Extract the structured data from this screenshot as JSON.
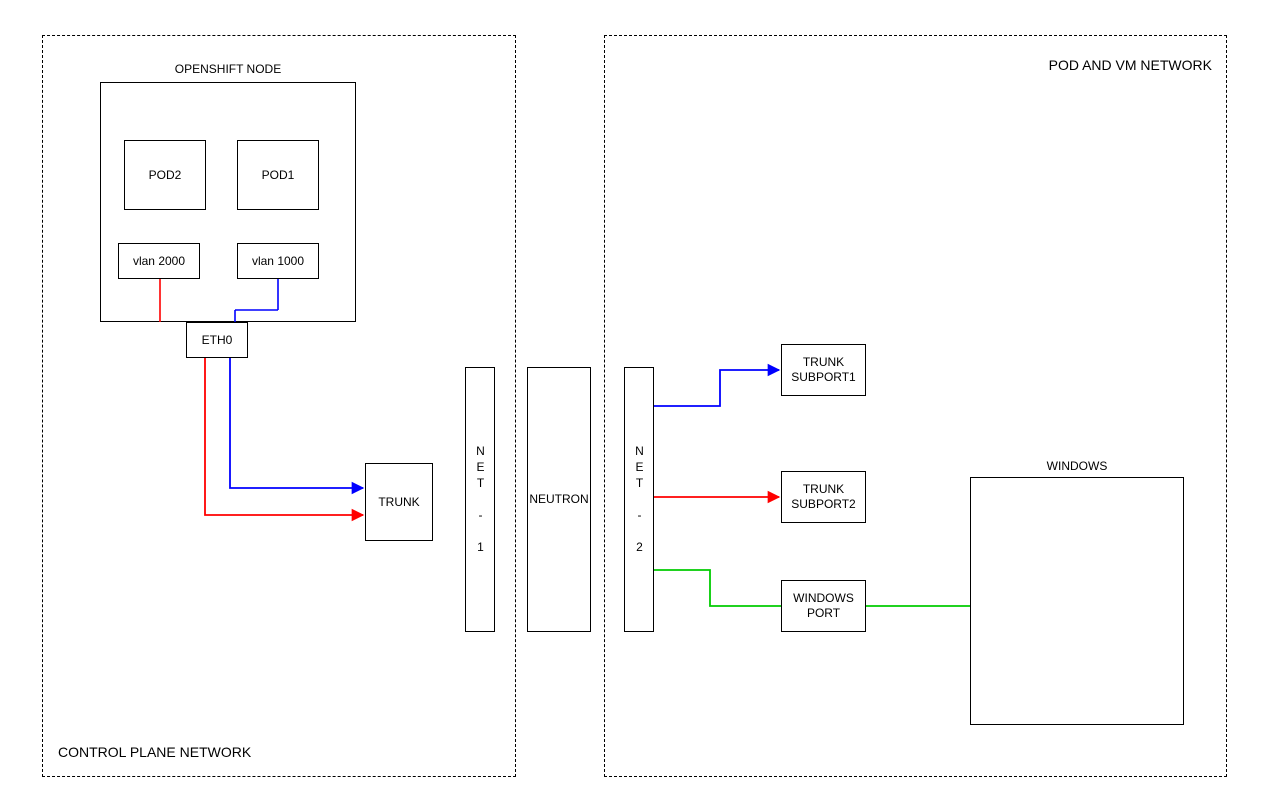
{
  "regions": {
    "control_plane_label": "CONTROL PLANE NETWORK",
    "pod_vm_label": "POD AND VM NETWORK"
  },
  "openshift_node": {
    "title": "OPENSHIFT NODE",
    "pod2": "POD2",
    "pod1": "POD1",
    "vlan2000": "vlan 2000",
    "vlan1000": "vlan 1000",
    "eth0": "ETH0"
  },
  "center": {
    "trunk": "TRUNK",
    "net1": "NET - 1",
    "neutron": "NEUTRON",
    "net2": "NET - 2"
  },
  "right": {
    "trunk_sub1": "TRUNK SUBPORT1",
    "trunk_sub2": "TRUNK SUBPORT2",
    "windows_port": "WINDOWS PORT",
    "windows": "WINDOWS"
  },
  "colors": {
    "blue": "#0000ff",
    "red": "#ff0000",
    "green": "#00cc00"
  }
}
